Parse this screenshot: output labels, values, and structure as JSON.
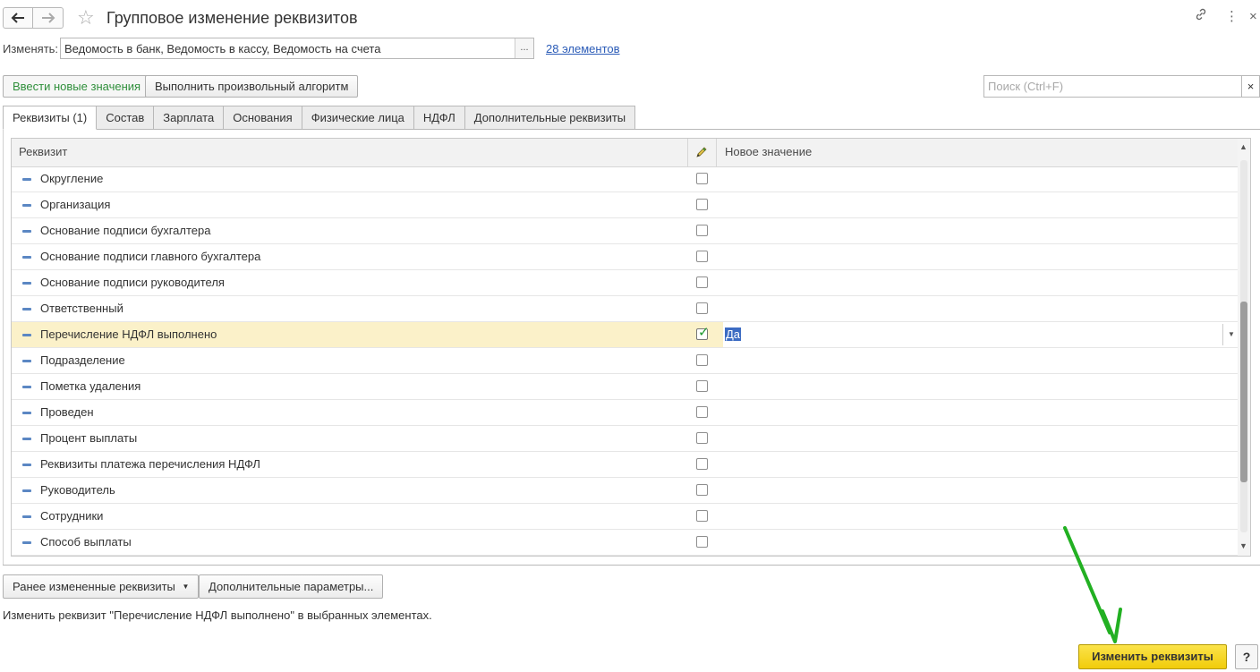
{
  "window": {
    "title": "Групповое изменение реквизитов",
    "back_icon": "arrow-left-icon",
    "forward_icon": "arrow-right-icon",
    "favorite_icon": "star-icon",
    "link_icon": "link-icon",
    "menu_icon": "more-vertical-icon",
    "close_icon": "close-icon"
  },
  "change": {
    "label": "Изменять:",
    "value": "Ведомость в банк, Ведомость в кассу, Ведомость на счета",
    "select_button": "...",
    "count_link": "28 элементов"
  },
  "commands": {
    "enter_new_values": "Ввести новые значения",
    "run_algorithm": "Выполнить произвольный алгоритм",
    "search_placeholder": "Поиск (Ctrl+F)",
    "search_clear": "×"
  },
  "tabs": [
    {
      "label": "Реквизиты (1)",
      "active": true
    },
    {
      "label": "Состав",
      "active": false
    },
    {
      "label": "Зарплата",
      "active": false
    },
    {
      "label": "Основания",
      "active": false
    },
    {
      "label": "Физические лица",
      "active": false
    },
    {
      "label": "НДФЛ",
      "active": false
    },
    {
      "label": "Дополнительные реквизиты",
      "active": false
    }
  ],
  "table": {
    "col_attribute": "Реквизит",
    "col_edit_icon": "pencil-icon",
    "col_new_value": "Новое значение",
    "rows": [
      {
        "name": "Округление",
        "checked": false,
        "value": ""
      },
      {
        "name": "Организация",
        "checked": false,
        "value": ""
      },
      {
        "name": "Основание подписи бухгалтера",
        "checked": false,
        "value": ""
      },
      {
        "name": "Основание подписи главного бухгалтера",
        "checked": false,
        "value": ""
      },
      {
        "name": "Основание подписи руководителя",
        "checked": false,
        "value": ""
      },
      {
        "name": "Ответственный",
        "checked": false,
        "value": ""
      },
      {
        "name": "Перечисление НДФЛ выполнено",
        "checked": true,
        "value": "Да",
        "selected": true
      },
      {
        "name": "Подразделение",
        "checked": false,
        "value": ""
      },
      {
        "name": "Пометка удаления",
        "checked": false,
        "value": ""
      },
      {
        "name": "Проведен",
        "checked": false,
        "value": ""
      },
      {
        "name": "Процент выплаты",
        "checked": false,
        "value": ""
      },
      {
        "name": "Реквизиты платежа перечисления НДФЛ",
        "checked": false,
        "value": ""
      },
      {
        "name": "Руководитель",
        "checked": false,
        "value": ""
      },
      {
        "name": "Сотрудники",
        "checked": false,
        "value": ""
      },
      {
        "name": "Способ выплаты",
        "checked": false,
        "value": ""
      }
    ]
  },
  "bottom": {
    "prev_changed": "Ранее измененные реквизиты",
    "extra_params": "Дополнительные параметры...",
    "status": "Изменить реквизит \"Перечисление НДФЛ выполнено\" в выбранных элементах.",
    "apply": "Изменить реквизиты",
    "help": "?"
  },
  "colors": {
    "accent_yellow": "#f1cc0b",
    "selected_row": "#fbf1c9",
    "link_blue": "#2a5bb7",
    "active_green": "#2f8f3b",
    "annotation_arrow": "#22b022"
  }
}
